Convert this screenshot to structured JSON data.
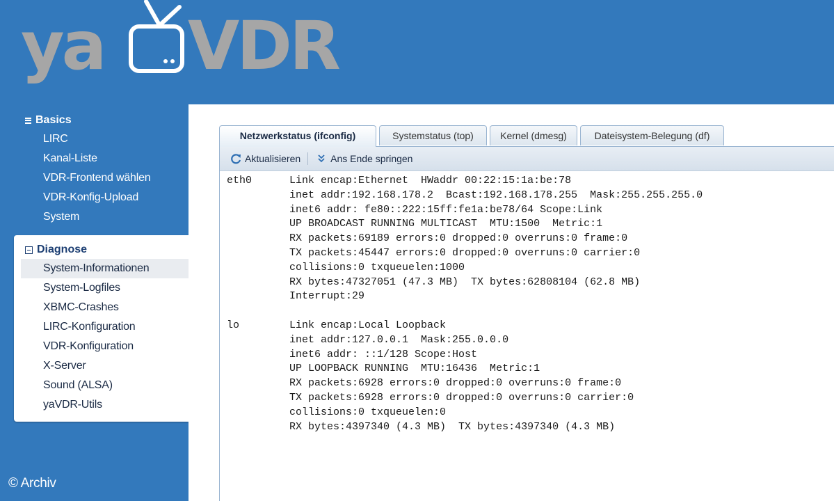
{
  "logo": {
    "text_left": "ya",
    "text_right": "VDR"
  },
  "sidebar": {
    "groups": [
      {
        "title": "Basics",
        "expanded": true,
        "items": [
          {
            "label": "LIRC"
          },
          {
            "label": "Kanal-Liste"
          },
          {
            "label": "VDR-Frontend wählen"
          },
          {
            "label": "VDR-Konfig-Upload"
          },
          {
            "label": "System"
          }
        ]
      },
      {
        "title": "Diagnose",
        "expanded": true,
        "items": [
          {
            "label": "System-Informationen",
            "active": true
          },
          {
            "label": "System-Logfiles"
          },
          {
            "label": "XBMC-Crashes"
          },
          {
            "label": "LIRC-Konfiguration"
          },
          {
            "label": "VDR-Konfiguration"
          },
          {
            "label": "X-Server"
          },
          {
            "label": "Sound (ALSA)"
          },
          {
            "label": "yaVDR-Utils"
          }
        ]
      }
    ]
  },
  "tabs": [
    {
      "label": "Netzwerkstatus (ifconfig)",
      "active": true
    },
    {
      "label": "Systemstatus (top)"
    },
    {
      "label": "Kernel (dmesg)"
    },
    {
      "label": "Dateisystem-Belegung (df)"
    }
  ],
  "toolbar": {
    "refresh_label": "Aktualisieren",
    "scroll_end_label": "Ans Ende springen"
  },
  "output_lines": [
    "eth0      Link encap:Ethernet  HWaddr 00:22:15:1a:be:78",
    "          inet addr:192.168.178.2  Bcast:192.168.178.255  Mask:255.255.255.0",
    "          inet6 addr: fe80::222:15ff:fe1a:be78/64 Scope:Link",
    "          UP BROADCAST RUNNING MULTICAST  MTU:1500  Metric:1",
    "          RX packets:69189 errors:0 dropped:0 overruns:0 frame:0",
    "          TX packets:45447 errors:0 dropped:0 overruns:0 carrier:0",
    "          collisions:0 txqueuelen:1000",
    "          RX bytes:47327051 (47.3 MB)  TX bytes:62808104 (62.8 MB)",
    "          Interrupt:29",
    "",
    "lo        Link encap:Local Loopback",
    "          inet addr:127.0.0.1  Mask:255.0.0.0",
    "          inet6 addr: ::1/128 Scope:Host",
    "          UP LOOPBACK RUNNING  MTU:16436  Metric:1",
    "          RX packets:6928 errors:0 dropped:0 overruns:0 frame:0",
    "          TX packets:6928 errors:0 dropped:0 overruns:0 carrier:0",
    "          collisions:0 txqueuelen:0",
    "          RX bytes:4397340 (4.3 MB)  TX bytes:4397340 (4.3 MB)"
  ],
  "copyright": "© Archiv",
  "colors": {
    "background": "#3379bc",
    "logo_gray": "#a6a6a6",
    "panel": "#ffffff",
    "tab_border": "#99b4d1",
    "heading_dark": "#1d3f73"
  }
}
